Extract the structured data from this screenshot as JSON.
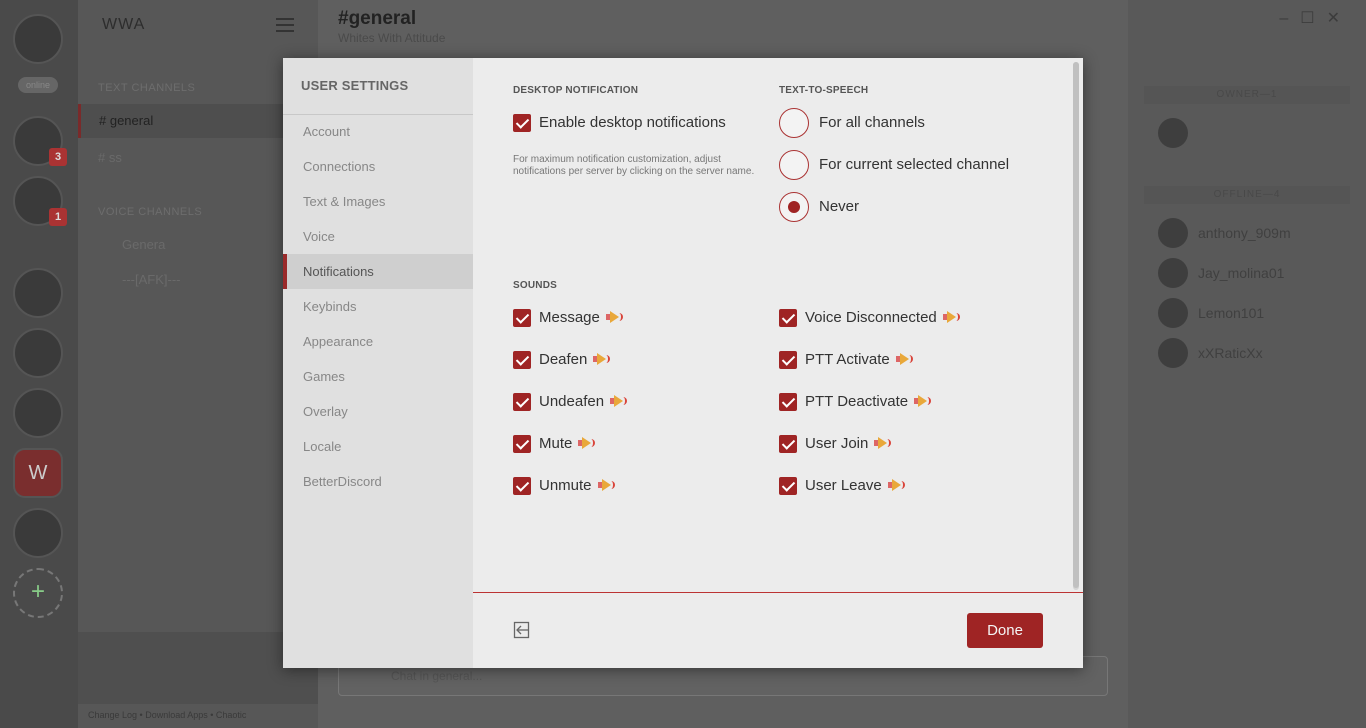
{
  "app": {
    "server_name": "WWA",
    "channel_title": "#general",
    "channel_subtitle": "Whites With Attitude",
    "online_pill": "online",
    "chat_placeholder": "Chat in general...",
    "footer_links": "Change Log  •  Download Apps  •  Chaotic"
  },
  "guilds": [
    {
      "badge": "3"
    },
    {
      "badge": "1"
    },
    {
      "badge": ""
    },
    {
      "badge": ""
    },
    {
      "badge": ""
    },
    {
      "label": "W"
    },
    {
      "badge": ""
    },
    {
      "label": "+"
    }
  ],
  "channels": {
    "text_heading": "TEXT CHANNELS",
    "items": [
      "# general",
      "# ss"
    ],
    "voice_heading": "VOICE CHANNELS",
    "voice_items": [
      "Genera",
      "---[AFK]---"
    ]
  },
  "members": {
    "owner_heading": "OWNER—1",
    "offline_heading": "OFFLINE—4",
    "offline": [
      "anthony_909m",
      "Jay_molina01",
      "Lemon101",
      "xXRaticXx"
    ]
  },
  "settings": {
    "title": "USER SETTINGS",
    "nav": [
      "Account",
      "Connections",
      "Text & Images",
      "Voice",
      "Notifications",
      "Keybinds",
      "Appearance",
      "Games",
      "Overlay",
      "Locale",
      "BetterDiscord"
    ],
    "selected_nav": "Notifications",
    "desktop": {
      "heading": "DESKTOP NOTIFICATION",
      "enable_label": "Enable desktop notifications",
      "enabled": true,
      "helper": "For maximum notification customization, adjust notifications per server by clicking on the server name."
    },
    "tts": {
      "heading": "TEXT-TO-SPEECH",
      "options": [
        "For all channels",
        "For current selected channel",
        "Never"
      ],
      "selected": "Never"
    },
    "sounds": {
      "heading": "SOUNDS",
      "left": [
        "Message",
        "Deafen",
        "Undeafen",
        "Mute",
        "Unmute"
      ],
      "right": [
        "Voice Disconnected",
        "PTT Activate",
        "PTT Deactivate",
        "User Join",
        "User Leave"
      ]
    },
    "done_label": "Done"
  },
  "colors": {
    "accent": "#9f2424",
    "modal_bg": "#ececec",
    "sidebar_bg": "#e0e0e0"
  },
  "icons": {
    "logout": "logout-icon",
    "speaker": "speaker-icon"
  }
}
